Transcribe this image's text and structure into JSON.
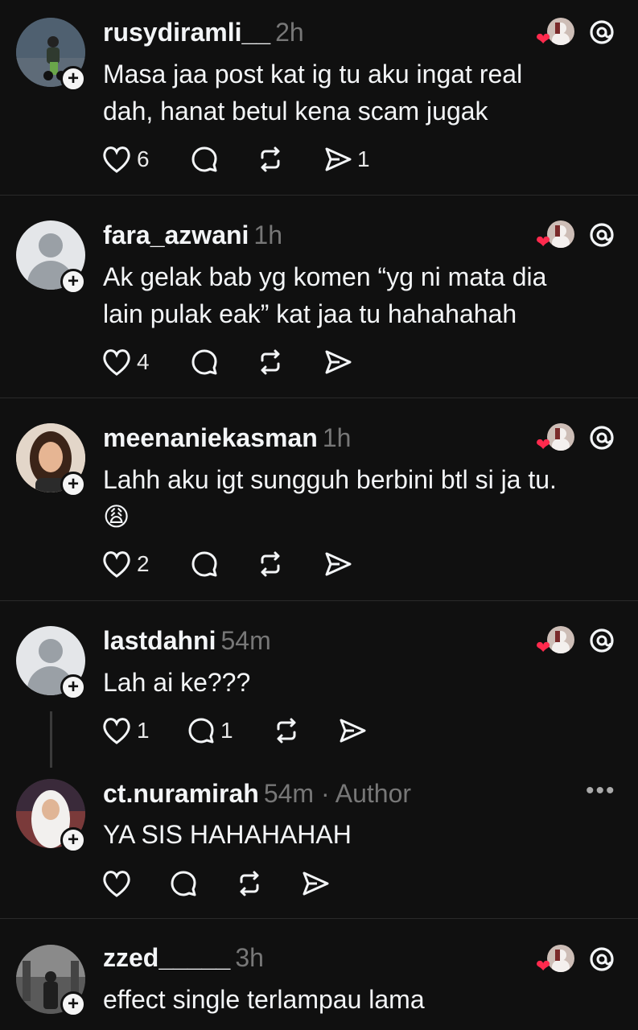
{
  "posts": [
    {
      "username": "rusydiramli__",
      "time": "2h",
      "text_line1": "Masa jaa post kat ig tu aku ingat real",
      "text_line2": "dah, hanat betul kena scam jugak",
      "likes": "6",
      "replies": "",
      "reposts": "",
      "shares": "1"
    },
    {
      "username": "fara_azwani",
      "time": "1h",
      "text_line1": "Ak gelak bab yg komen “yg ni mata dia",
      "text_line2": "lain pulak eak” kat jaa tu hahahahah",
      "likes": "4"
    },
    {
      "username": "meenaniekasman",
      "time": "1h",
      "text_line1": "Lahh aku igt sungguh berbini btl si ja tu.",
      "text_line2": "😩",
      "likes": "2"
    },
    {
      "username": "lastdahni",
      "time": "54m",
      "text_line1": "Lah ai ke???",
      "likes": "1",
      "replies": "1"
    },
    {
      "username": "ct.nuramirah",
      "time": "54m",
      "author_tag": "· Author",
      "text_line1": "YA SIS HAHAHAHAH"
    },
    {
      "username": "zzed_____",
      "time": "3h",
      "text_line1": "effect single terlampau lama"
    }
  ],
  "more_menu": "•••",
  "colors": {
    "background": "#101010",
    "text": "#f3f5f7",
    "muted": "#777777",
    "heart": "#ff2a4d",
    "divider": "#2a2a2a"
  },
  "icons": [
    "heart-icon",
    "comment-icon",
    "repost-icon",
    "share-icon",
    "threads-icon",
    "follow-plus-icon"
  ]
}
